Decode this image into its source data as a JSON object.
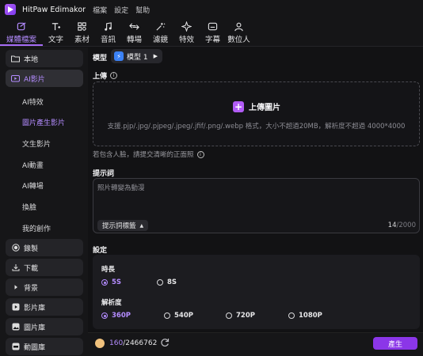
{
  "app": {
    "name": "HitPaw Edimakor",
    "menu": [
      "檔案",
      "設定",
      "幫助"
    ]
  },
  "toolbar": [
    {
      "label": "媒體檔案",
      "icon": "media-icon",
      "active": true
    },
    {
      "label": "文字",
      "icon": "text-icon"
    },
    {
      "label": "素材",
      "icon": "material-icon"
    },
    {
      "label": "音訊",
      "icon": "audio-icon"
    },
    {
      "label": "轉場",
      "icon": "transition-icon"
    },
    {
      "label": "濾鏡",
      "icon": "filter-icon"
    },
    {
      "label": "特效",
      "icon": "effects-icon"
    },
    {
      "label": "字幕",
      "icon": "subtitle-icon"
    },
    {
      "label": "數位人",
      "icon": "digital-human-icon"
    }
  ],
  "sidebar": {
    "local": "本地",
    "ai_video": "AI影片",
    "ai_subitems": [
      "AI特效",
      "圖片產生影片",
      "文生影片",
      "AI動畫",
      "AI轉場",
      "換臉",
      "我的創作"
    ],
    "record": "錄製",
    "download": "下載",
    "background": "背景",
    "video_library": "影片庫",
    "image_library": "圖片庫",
    "gif_library": "動圖庫"
  },
  "main": {
    "model_label": "模型",
    "model_value": "模型 1",
    "upload_label": "上傳",
    "upload_button": "上傳圖片",
    "upload_hint": "支援.pjp/.jpg/.pjpeg/.jpeg/.jfif/.png/.webp 格式，大小不超過20MB，解析度不超過 4000*4000",
    "face_note": "若包含人臉，請提交清晰的正面照",
    "prompt_label": "提示詞",
    "prompt_placeholder": "照片轉變為動漫",
    "prompt_tag_button": "提示詞標籤",
    "prompt_count": "14",
    "prompt_max": "/2000",
    "settings_label": "設定",
    "duration_label": "時長",
    "duration_options": [
      "5S",
      "8S"
    ],
    "resolution_label": "解析度",
    "resolution_options": [
      "360P",
      "540P",
      "720P",
      "1080P"
    ]
  },
  "footer": {
    "credits_used": "160",
    "credits_total": "/2466762",
    "generate_label": "產生"
  },
  "colors": {
    "accent": "#b48cff",
    "button": "#8b36e8",
    "background": "#121214"
  }
}
